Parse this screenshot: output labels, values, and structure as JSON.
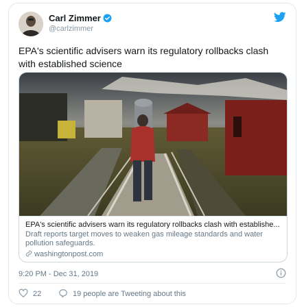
{
  "tweet": {
    "author": {
      "display_name": "Carl Zimmer",
      "handle": "@carlzimmer",
      "verified": true,
      "avatar_icon": "avatar-photo"
    },
    "brand_icon": "twitter-bird-icon",
    "text": "EPA's scientific advisers warn its regulatory rollbacks clash with established science",
    "card": {
      "image_description_icon": "article-photo",
      "title": "EPA's scientific advisers warn its regulatory rollbacks clash with establishe...",
      "description": "Draft reports target moves to weaken gas mileage standards and water pollution safeguards.",
      "domain": "washingtonpost.com"
    },
    "timestamp": "9:20 PM - Dec 31, 2019",
    "likes_count": "22",
    "reply_label": "19 people are Tweeting about this"
  },
  "colors": {
    "accent": "#1da1f2",
    "muted": "#657786",
    "like_icon": "#e0245e"
  }
}
